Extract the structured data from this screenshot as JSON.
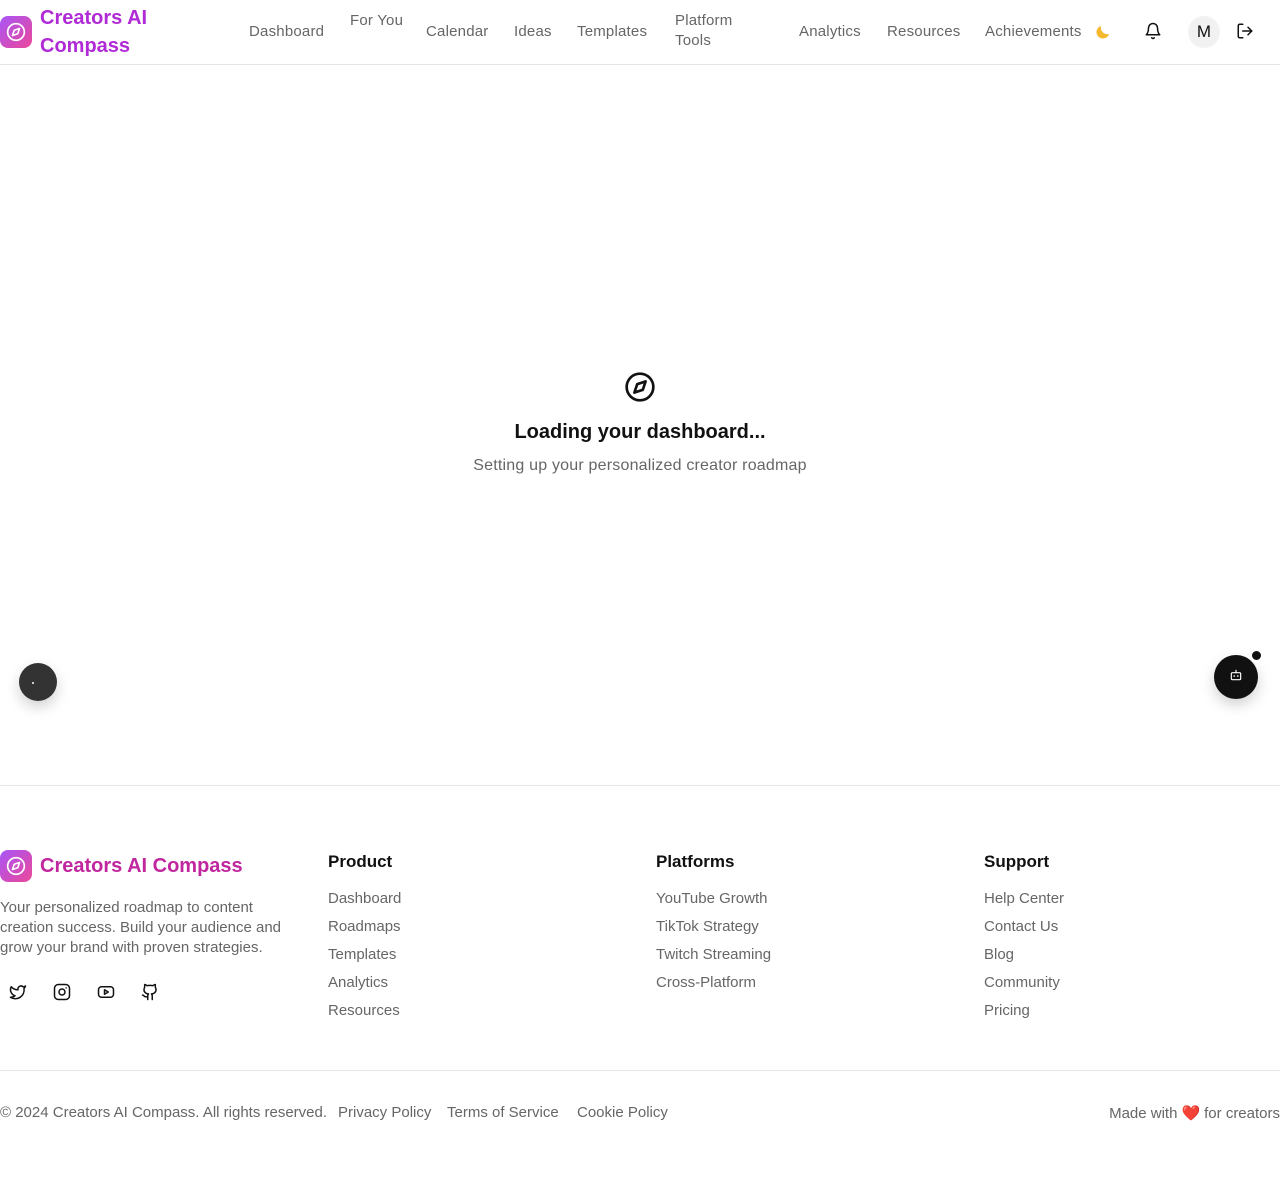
{
  "brand": {
    "name": "Creators AI Compass"
  },
  "nav": {
    "items": [
      {
        "label": "Dashboard"
      },
      {
        "label": "For You"
      },
      {
        "label": "Calendar"
      },
      {
        "label": "Ideas"
      },
      {
        "label": "Templates"
      },
      {
        "label": "Platform Tools"
      },
      {
        "label": "Analytics"
      },
      {
        "label": "Resources"
      },
      {
        "label": "Achievements"
      }
    ],
    "theme_icon": "moon-icon",
    "notifications_icon": "bell-icon",
    "avatar_initial": "M",
    "logout_icon": "logout-icon"
  },
  "loading": {
    "icon": "compass-icon",
    "title": "Loading your dashboard...",
    "subtitle": "Setting up your personalized creator roadmap"
  },
  "floating": {
    "left_icon": "dot-icon",
    "right_icon": "bot-icon"
  },
  "footer": {
    "brand_name": "Creators AI Compass",
    "description": "Your personalized roadmap to content creation success. Build your audience and grow your brand with proven strategies.",
    "social_icons": [
      "twitter-icon",
      "instagram-icon",
      "youtube-icon",
      "github-icon"
    ],
    "columns": [
      {
        "heading": "Product",
        "links": [
          "Dashboard",
          "Roadmaps",
          "Templates",
          "Analytics",
          "Resources"
        ]
      },
      {
        "heading": "Platforms",
        "links": [
          "YouTube Growth",
          "TikTok Strategy",
          "Twitch Streaming",
          "Cross-Platform"
        ]
      },
      {
        "heading": "Support",
        "links": [
          "Help Center",
          "Contact Us",
          "Blog",
          "Community",
          "Pricing"
        ]
      }
    ],
    "copyright": "© 2024 Creators AI Compass. All rights reserved.",
    "legal_links": [
      "Privacy Policy",
      "Terms of Service",
      "Cookie Policy"
    ],
    "made_with_prefix": "Made with",
    "made_with_heart": "❤️",
    "made_with_suffix": "for creators"
  },
  "colors": {
    "brand_gradient_start": "#a855f7",
    "brand_gradient_end": "#ec4899",
    "brand_text": "#b02ad6",
    "muted_text": "#666666",
    "divider": "#e5e5e5"
  }
}
